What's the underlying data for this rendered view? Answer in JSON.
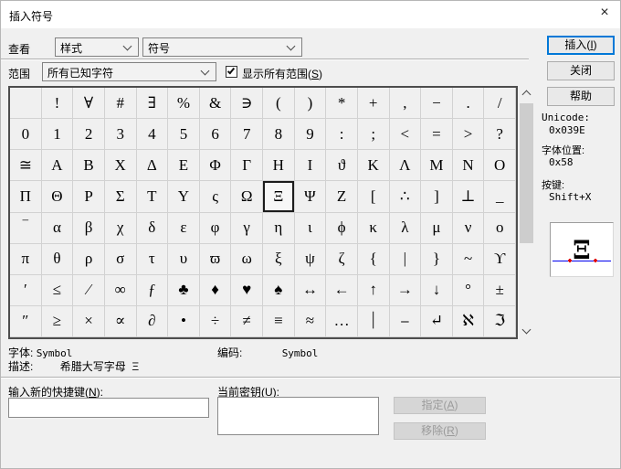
{
  "window": {
    "title": "插入符号",
    "close_icon": "×"
  },
  "toolbar": {
    "view_label": "查看",
    "style_combo_value": "样式",
    "subset_combo_value": "符号",
    "range_label": "范围",
    "range_combo_value": "所有已知字符",
    "show_all_ranges_label": {
      "pre": "显示所有范围(",
      "key": "S",
      "post": ")"
    },
    "insert_button": {
      "pre": "插入(",
      "key": "I",
      "post": ")"
    },
    "close_button": "关闭",
    "help_button": "帮助"
  },
  "info_panel": {
    "unicode_label": "Unicode:",
    "unicode_value": "0x039E",
    "font_pos_label": "字体位置:",
    "font_pos_value": "0x58",
    "key_label": "按键:",
    "key_value": "Shift+X",
    "preview_char": "Ξ"
  },
  "grid": {
    "rows": [
      [
        "",
        "!",
        "∀",
        "#",
        "∃",
        "%",
        "&",
        "∋",
        "(",
        ")",
        "*",
        "+",
        ",",
        "−",
        ".",
        "/"
      ],
      [
        "0",
        "1",
        "2",
        "3",
        "4",
        "5",
        "6",
        "7",
        "8",
        "9",
        ":",
        ";",
        "<",
        "=",
        ">",
        "?"
      ],
      [
        "≅",
        "A",
        "B",
        "X",
        "Δ",
        "E",
        "Φ",
        "Γ",
        "H",
        "I",
        "ϑ",
        "K",
        "Λ",
        "M",
        "N",
        "O"
      ],
      [
        "Π",
        "Θ",
        "P",
        "Σ",
        "T",
        "Y",
        "ς",
        "Ω",
        "Ξ",
        "Ψ",
        "Z",
        "[",
        "∴",
        "]",
        "⊥",
        "_"
      ],
      [
        "‾",
        "α",
        "β",
        "χ",
        "δ",
        "ε",
        "φ",
        "γ",
        "η",
        "ι",
        "ϕ",
        "κ",
        "λ",
        "μ",
        "ν",
        "ο"
      ],
      [
        "π",
        "θ",
        "ρ",
        "σ",
        "τ",
        "υ",
        "ϖ",
        "ω",
        "ξ",
        "ψ",
        "ζ",
        "{",
        "|",
        "}",
        "~",
        "ϒ"
      ],
      [
        "′",
        "≤",
        "⁄",
        "∞",
        "ƒ",
        "♣",
        "♦",
        "♥",
        "♠",
        "↔",
        "←",
        "↑",
        "→",
        "↓",
        "°",
        "±"
      ],
      [
        "″",
        "≥",
        "×",
        "∝",
        "∂",
        "•",
        "÷",
        "≠",
        "≡",
        "≈",
        "…",
        "⏐",
        "⎯",
        "↵",
        "ℵ",
        "ℑ"
      ]
    ],
    "selected": {
      "row": 3,
      "col": 8
    }
  },
  "details": {
    "font_label": "字体:",
    "font_value": "Symbol",
    "encoding_label": "编码:",
    "encoding_value": "Symbol",
    "desc_label": "描述:",
    "desc_value": "希腊大写字母  Ξ"
  },
  "shortcut": {
    "new_key_label": {
      "pre": "输入新的快捷键(",
      "key": "N",
      "post": "):"
    },
    "current_key_label": {
      "pre": "当前密钥(",
      "key": "U",
      "post": "):"
    },
    "new_key_value": "",
    "current_key_value": "",
    "assign_button": {
      "pre": "指定(",
      "key": "A",
      "post": ")"
    },
    "remove_button": {
      "pre": "移除(",
      "key": "R",
      "post": ")"
    }
  },
  "colors": {
    "accent": "#0078d7",
    "baseline": "#0000ee",
    "caret_mark": "#e00000",
    "selection_border": "#1c1c1c"
  }
}
